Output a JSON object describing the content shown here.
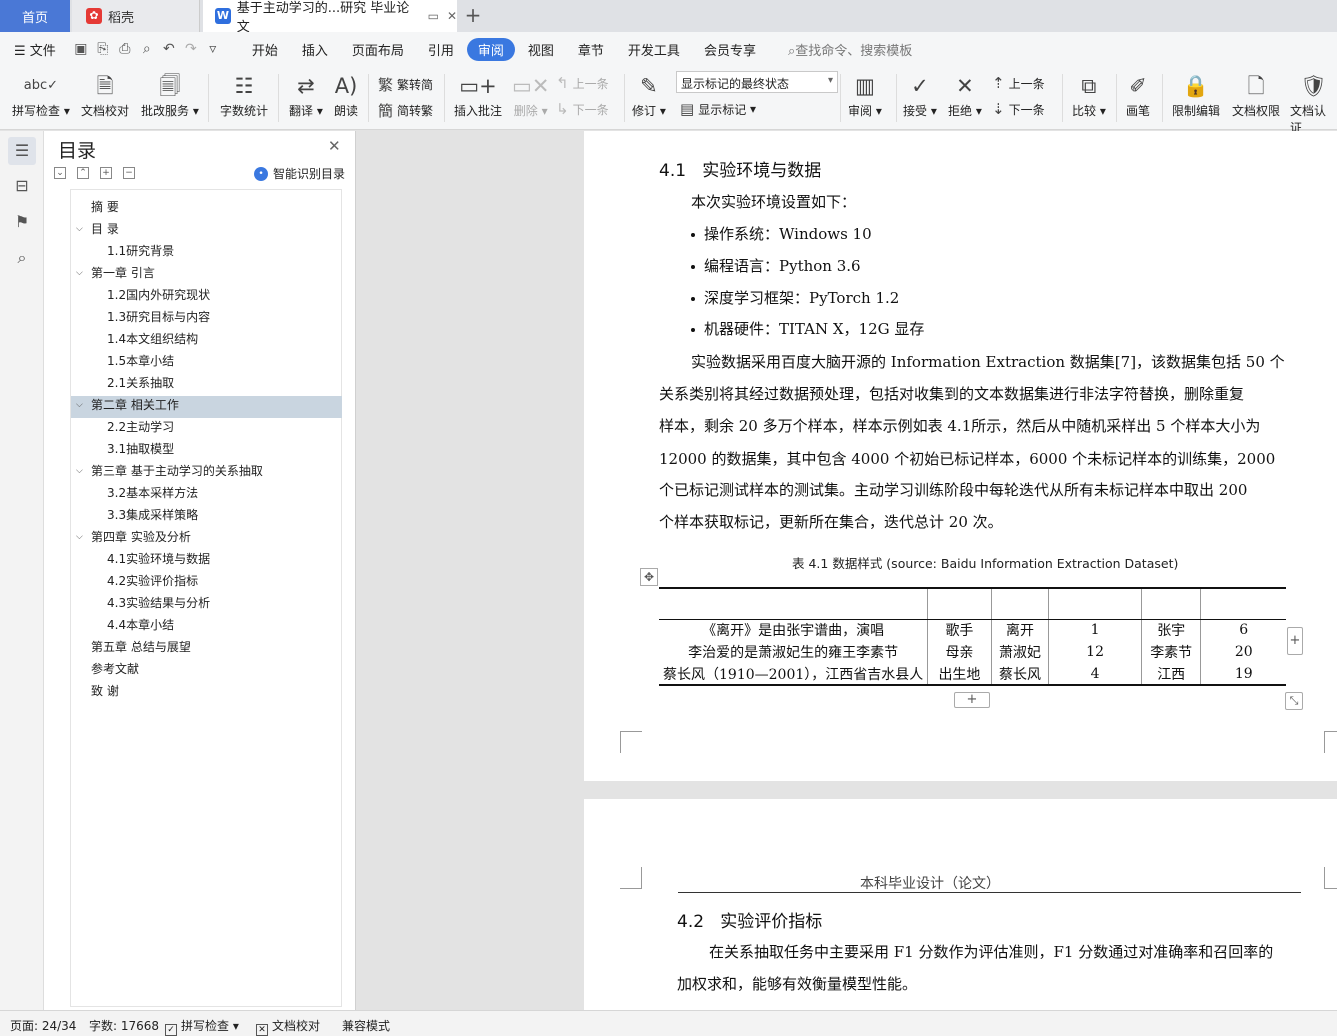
{
  "tabs": {
    "home": "首页",
    "docer": "稻壳",
    "doc": "基于主动学习的...研究 毕业论文",
    "new_tab": "+"
  },
  "menubar": {
    "file": "文件",
    "tabs": [
      "开始",
      "插入",
      "页面布局",
      "引用",
      "审阅",
      "视图",
      "章节",
      "开发工具",
      "会员专享"
    ],
    "active": "审阅",
    "search": "查找命令、搜索模板"
  },
  "ribbon": {
    "spell_check": "拼写检查",
    "doc_proof": "文档校对",
    "annotate_service": "批改服务",
    "word_count": "字数统计",
    "translate": "翻译",
    "read_aloud": "朗读",
    "trad_to_simp": "繁转简",
    "simp_to_trad": "简转繁",
    "insert_comment": "插入批注",
    "delete": "删除",
    "prev_comment": "上一条",
    "next_comment": "下一条",
    "track_changes": "修订",
    "markup_mode": "显示标记的最终状态",
    "show_markup": "显示标记",
    "review": "审阅",
    "accept": "接受",
    "reject": "拒绝",
    "prev_change": "上一条",
    "next_change": "下一条",
    "compare": "比较",
    "pen": "画笔",
    "restrict_edit": "限制编辑",
    "doc_permission": "文档权限",
    "doc_cert": "文档认证"
  },
  "toc": {
    "title": "目录",
    "smart": "智能识别目录",
    "items": [
      {
        "text": "摘  要",
        "level": 1,
        "caret": ""
      },
      {
        "text": "目  录",
        "level": 1,
        "caret": "v"
      },
      {
        "text": "1.1研究背景",
        "level": 2,
        "caret": ""
      },
      {
        "text": "第一章  引言",
        "level": 1,
        "caret": "v"
      },
      {
        "text": "1.2国内外研究现状",
        "level": 2,
        "caret": ""
      },
      {
        "text": "1.3研究目标与内容",
        "level": 2,
        "caret": ""
      },
      {
        "text": "1.4本文组织结构",
        "level": 2,
        "caret": ""
      },
      {
        "text": "1.5本章小结",
        "level": 2,
        "caret": ""
      },
      {
        "text": "2.1关系抽取",
        "level": 2,
        "caret": ""
      },
      {
        "text": "第二章  相关工作",
        "level": 1,
        "caret": "v"
      },
      {
        "text": "2.2主动学习",
        "level": 2,
        "caret": ""
      },
      {
        "text": "3.1抽取模型",
        "level": 2,
        "caret": ""
      },
      {
        "text": "第三章  基于主动学习的关系抽取",
        "level": 1,
        "caret": "v"
      },
      {
        "text": "3.2基本采样方法",
        "level": 2,
        "caret": ""
      },
      {
        "text": "3.3集成采样策略",
        "level": 2,
        "caret": ""
      },
      {
        "text": "第四章  实验及分析",
        "level": 1,
        "caret": "v"
      },
      {
        "text": "4.1实验环境与数据",
        "level": 2,
        "caret": ""
      },
      {
        "text": "4.2实验评价指标",
        "level": 2,
        "caret": ""
      },
      {
        "text": "4.3实验结果与分析",
        "level": 2,
        "caret": ""
      },
      {
        "text": "4.4本章小结",
        "level": 2,
        "caret": ""
      },
      {
        "text": "第五章  总结与展望",
        "level": 1,
        "caret": ""
      },
      {
        "text": "参考文献",
        "level": 1,
        "caret": ""
      },
      {
        "text": "致  谢",
        "level": 1,
        "caret": ""
      }
    ]
  },
  "doc": {
    "h41_num": "4.1",
    "h41_title": "实验环境与数据",
    "intro": "本次实验环境设置如下：",
    "bullets": [
      "操作系统：Windows 10",
      "编程语言：Python 3.6",
      "深度学习框架：PyTorch 1.2",
      "机器硬件：TITAN X，12G 显存"
    ],
    "para_lines": [
      "实验数据采用百度大脑开源的  Information Extraction 数据集[7]，该数据集包括  50 个",
      "关系类别将其经过数据预处理，包括对收集到的文本数据集进行非法字符替换，删除重复",
      "样本，剩余  20 多万个样本，样本示例如表 4.1所示，然后从中随机采样出  5 个样本大小为",
      " 12000 的数据集，其中包含  4000 个初始已标记样本，6000 个未标记样本的训练集，2000",
      "个已标记测试样本的测试集。主动学习训练阶段中每轮迭代从所有未标记样本中取出  200",
      "个样本获取标记，更新所在集合，迭代总计  20 次。"
    ],
    "table_caption": "表  4.1 数据样式  (source: Baidu Information Extraction Dataset)",
    "table_headers": [
      "",
      "",
      "",
      "",
      "",
      ""
    ],
    "table_rows": [
      [
        "《离开》是由张宇谱曲，演唱",
        "歌手",
        "离开",
        "1",
        "张宇",
        "6"
      ],
      [
        "李治爱的是萧淑妃生的雍王李素节",
        "母亲",
        "萧淑妃",
        "12",
        "李素节",
        "20"
      ],
      [
        "蔡长风（1910—2001），江西省吉水县人",
        "出生地",
        "蔡长风",
        "4",
        "江西",
        "19"
      ]
    ],
    "page2_header": "本科毕业设计（论文）",
    "h42_num": "4.2",
    "h42_title": "实验评价指标",
    "p2_lines": [
      "在关系抽取任务中主要采用  F1 分数作为评估准则，F1 分数通过对准确率和召回率的",
      "加权求和，能够有效衡量模型性能。"
    ]
  },
  "status": {
    "page": "页面: 24/34",
    "words": "字数: 17668",
    "spell": "拼写检查",
    "proof": "文档校对",
    "compat": "兼容模式"
  }
}
